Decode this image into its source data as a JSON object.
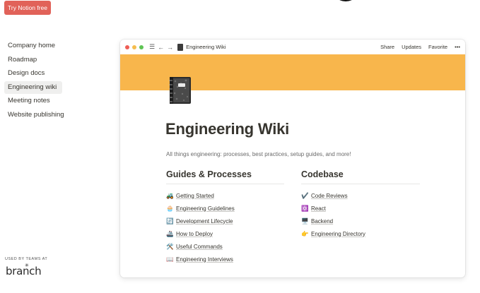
{
  "cta": {
    "label": "Try Notion free"
  },
  "sidebar": {
    "items": [
      {
        "label": "Company home"
      },
      {
        "label": "Roadmap"
      },
      {
        "label": "Design docs"
      },
      {
        "label": "Engineering wiki",
        "active": true
      },
      {
        "label": "Meeting notes"
      },
      {
        "label": "Website publishing"
      }
    ]
  },
  "footer": {
    "used_by": "USED BY TEAMS AT",
    "brand": "branch"
  },
  "window": {
    "breadcrumb": "Engineering Wiki",
    "actions": {
      "share": "Share",
      "updates": "Updates",
      "favorite": "Favorite",
      "more": "•••"
    },
    "cover_color": "#f8b64c"
  },
  "page": {
    "icon": "notebook-icon",
    "title": "Engineering Wiki",
    "subtitle": "All things engineering: processes, best practices, setup guides, and more!",
    "guides": {
      "heading": "Guides & Processes",
      "links": [
        {
          "icon": "🚜",
          "label": "Getting Started"
        },
        {
          "icon": "🧁",
          "label": "Engineering Guidelines"
        },
        {
          "icon": "🔄",
          "label": "Development Lifecycle"
        },
        {
          "icon": "🚢",
          "label": "How to Deploy"
        },
        {
          "icon": "🛠️",
          "label": "Useful Commands"
        },
        {
          "icon": "📖",
          "label": "Engineering Interviews"
        }
      ]
    },
    "codebase": {
      "heading": "Codebase",
      "links": [
        {
          "icon": "✔️",
          "label": "Code Reviews"
        },
        {
          "icon": "⚛️",
          "label": "React"
        },
        {
          "icon": "🖥️",
          "label": "Backend"
        },
        {
          "icon": "👉",
          "label": "Engineering Directory"
        }
      ]
    }
  }
}
